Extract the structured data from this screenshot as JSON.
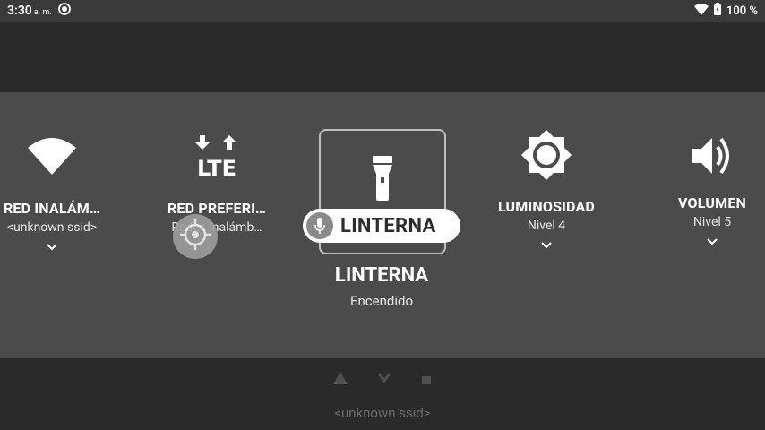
{
  "status_bar": {
    "time": "3:30",
    "ampm": "a. m.",
    "battery_pct": "100 %"
  },
  "background_app": {
    "ssid": "<unknown ssid>"
  },
  "quick_settings": {
    "wifi": {
      "title": "RED INALÁM…",
      "subtitle": "<unknown ssid>",
      "icon": "wifi-icon"
    },
    "network": {
      "title": "RED PREFERI…",
      "subtitle": "Redes inalámb…",
      "icon_text": "LTE",
      "icon": "lte-arrows-icon"
    },
    "flashlight": {
      "title": "LINTERNA",
      "subtitle": "Encendido",
      "icon": "flashlight-icon"
    },
    "brightness": {
      "title": "LUMINOSIDAD",
      "subtitle": "Nivel 4",
      "icon": "brightness-icon"
    },
    "volume": {
      "title": "VOLUMEN",
      "subtitle": "Nivel 5",
      "icon": "volume-icon"
    }
  },
  "voice_overlay": {
    "label": "LINTERNA",
    "icon": "microphone-icon"
  },
  "floating_button": {
    "icon": "crosshair-icon"
  },
  "colors": {
    "panel_bg": "#4b4b4b",
    "screen_bg": "#2a2a2a",
    "status_bg": "#3a3a3a",
    "text": "#ffffff"
  }
}
